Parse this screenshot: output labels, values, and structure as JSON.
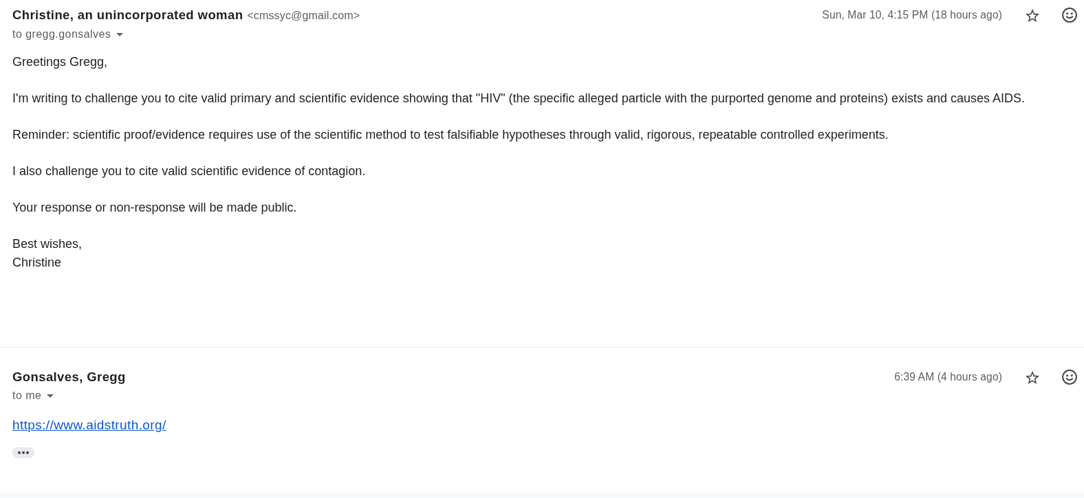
{
  "messages": [
    {
      "sender": "Christine, an unincorporated woman",
      "sender_email": "<cmssyc@gmail.com>",
      "recipients": "to gregg.gonsalves",
      "date": "Sun, Mar 10, 4:15 PM (18 hours ago)",
      "starred": false,
      "body": [
        {
          "kind": "text",
          "lines": [
            "Greetings Gregg,"
          ]
        },
        {
          "kind": "text",
          "lines": [
            "I'm writing to challenge you to cite valid primary and scientific evidence showing that \"HIV\" (the specific alleged particle with the purported genome and proteins) exists and causes AIDS."
          ]
        },
        {
          "kind": "text",
          "lines": [
            "Reminder: scientific proof/evidence requires use of the scientific method to test falsifiable hypotheses through valid, rigorous, repeatable controlled experiments."
          ]
        },
        {
          "kind": "text",
          "lines": [
            "I also challenge you to cite valid scientific evidence of contagion."
          ]
        },
        {
          "kind": "text",
          "lines": [
            "Your response or non-response will be made public."
          ]
        },
        {
          "kind": "text",
          "lines": [
            "Best wishes,",
            "Christine"
          ]
        }
      ]
    },
    {
      "sender": "Gonsalves, Gregg",
      "recipients": "to me",
      "date": "6:39 AM (4 hours ago)",
      "starred": false,
      "body": [
        {
          "kind": "link",
          "lines": [
            "https://www.aidstruth.org/"
          ]
        }
      ],
      "trimmed_content": true
    }
  ]
}
